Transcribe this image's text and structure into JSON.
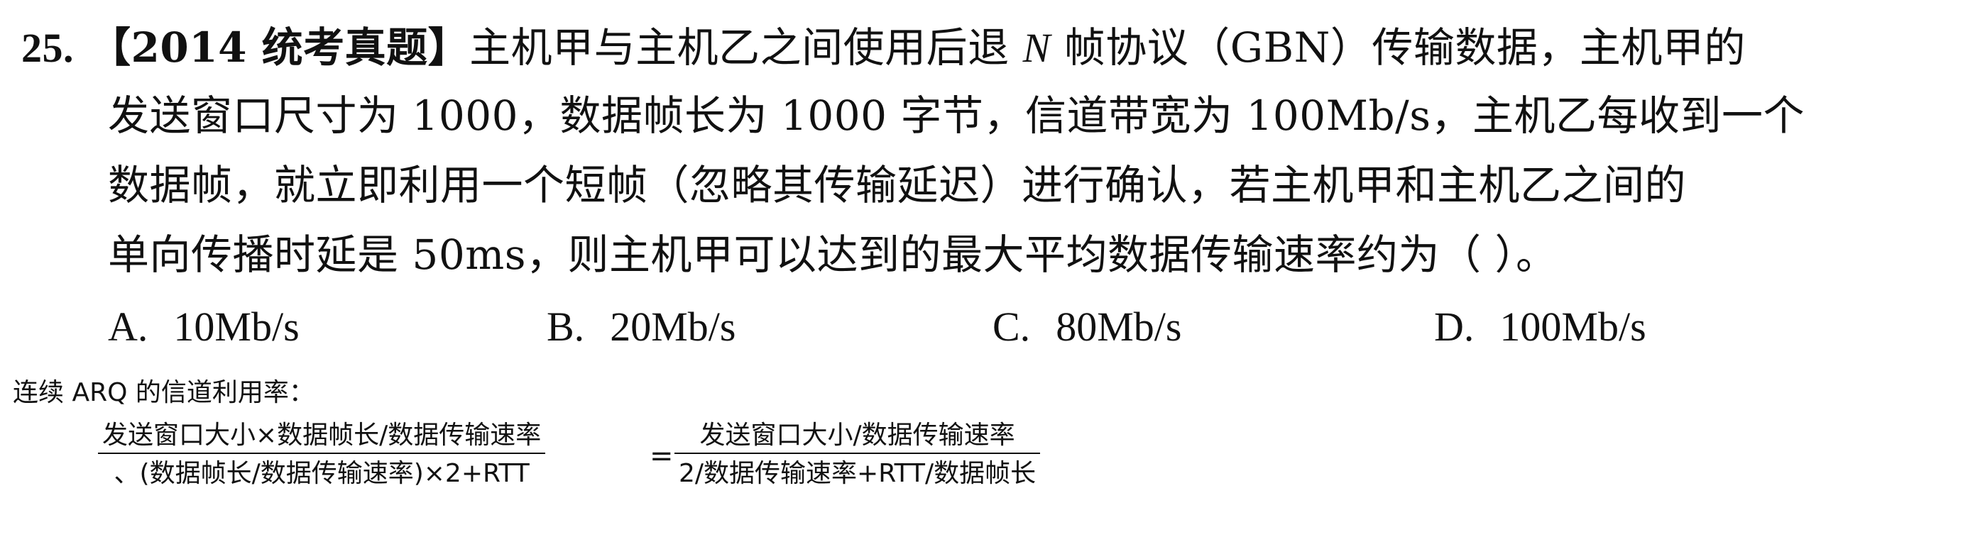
{
  "question": {
    "number": "25.",
    "line1_tag": "【2014 统考真题】",
    "line1_text_a": "主机甲与主机乙之间使用后退 ",
    "line1_var": "N",
    "line1_text_b": " 帧协议（GBN）传输数据，主机甲的",
    "line2": "发送窗口尺寸为 1000，数据帧长为 1000 字节，信道带宽为 100Mb/s，主机乙每收到一个",
    "line3": "数据帧，就立即利用一个短帧（忽略其传输延迟）进行确认，若主机甲和主机乙之间的",
    "line4": "单向传播时延是 50ms，则主机甲可以达到的最大平均数据传输速率约为（  ）。",
    "options": [
      {
        "letter": "A.",
        "value": "10Mb/s"
      },
      {
        "letter": "B.",
        "value": "20Mb/s"
      },
      {
        "letter": "C.",
        "value": "80Mb/s"
      },
      {
        "letter": "D.",
        "value": "100Mb/s"
      }
    ]
  },
  "note": {
    "title": "连续 ARQ 的信道利用率：",
    "fraction1": {
      "numerator": "发送窗口大小×数据帧长/数据传输速率",
      "denominator": "、(数据帧长/数据传输速率)×2+RTT"
    },
    "equals": "=",
    "fraction2": {
      "numerator": "发送窗口大小/数据传输速率",
      "denominator": "2/数据传输速率+RTT/数据帧长"
    }
  }
}
